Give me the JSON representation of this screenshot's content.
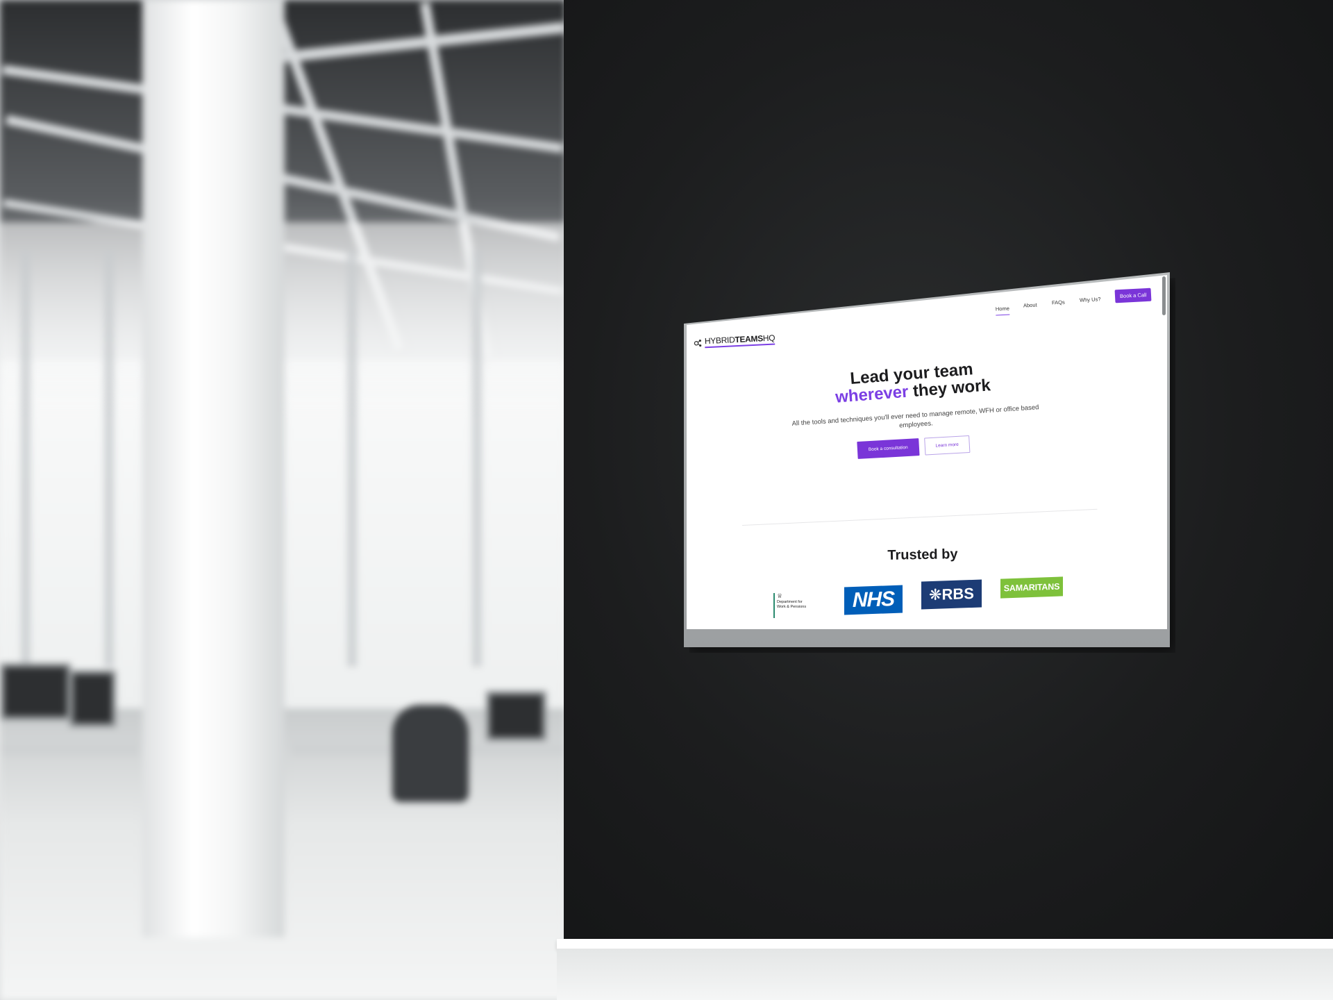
{
  "website": {
    "logo": {
      "prefix": "HYBRID",
      "bold": "TEAMS",
      "suffix": "HQ"
    },
    "nav": {
      "items": [
        {
          "label": "Home",
          "active": true
        },
        {
          "label": "About",
          "active": false
        },
        {
          "label": "FAQs",
          "active": false
        },
        {
          "label": "Why Us?",
          "active": false
        }
      ],
      "cta_label": "Book a Call"
    },
    "hero": {
      "headline_line1": "Lead your team",
      "headline_accent": "wherever",
      "headline_line2_rest": " they work",
      "subtext": "All the tools and techniques you'll ever need to manage remote, WFH or office based employees.",
      "primary_button": "Book a consultation",
      "secondary_button": "Learn more"
    },
    "trusted": {
      "title": "Trusted by",
      "logos": {
        "dwp": "Department for Work & Pensions",
        "nhs": "NHS",
        "rbs": "RBS",
        "samaritans": "SAMARITANS"
      }
    }
  },
  "colors": {
    "accent": "#7a35d8",
    "nhs_blue": "#005eb8",
    "rbs_navy": "#1d3c75",
    "samaritans_green": "#7ec13b",
    "wall": "#1c1d1e"
  }
}
